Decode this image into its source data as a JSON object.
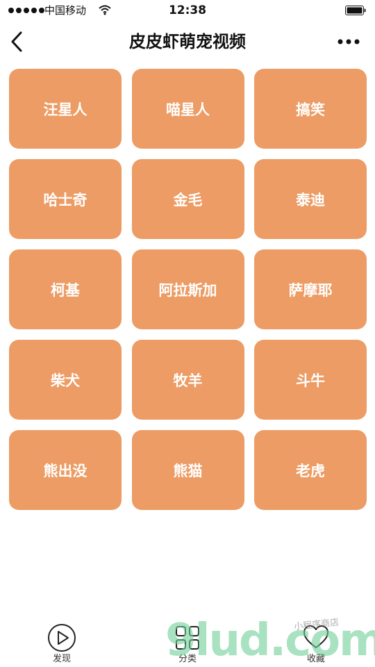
{
  "status_bar": {
    "carrier": "中国移动",
    "time": "12:38",
    "icons": [
      "signal-icon",
      "wifi-icon",
      "battery-icon"
    ]
  },
  "nav": {
    "title": "皮皮虾萌宠视频",
    "back_icon": "chevron-left-icon",
    "more_icon": "more-icon"
  },
  "categories": [
    "汪星人",
    "喵星人",
    "搞笑",
    "哈士奇",
    "金毛",
    "泰迪",
    "柯基",
    "阿拉斯加",
    "萨摩耶",
    "柴犬",
    "牧羊",
    "斗牛",
    "熊出没",
    "熊猫",
    "老虎"
  ],
  "tabs": [
    {
      "label": "发现",
      "icon": "play-circle-icon"
    },
    {
      "label": "分类",
      "icon": "grid-icon"
    },
    {
      "label": "收藏",
      "icon": "heart-icon"
    }
  ],
  "watermark": {
    "logo_text": "9lud.com",
    "subtext": "小程序商店"
  },
  "colors": {
    "tile": "#ec9c64",
    "tile_text": "#ffffff",
    "background": "#ffffff"
  }
}
